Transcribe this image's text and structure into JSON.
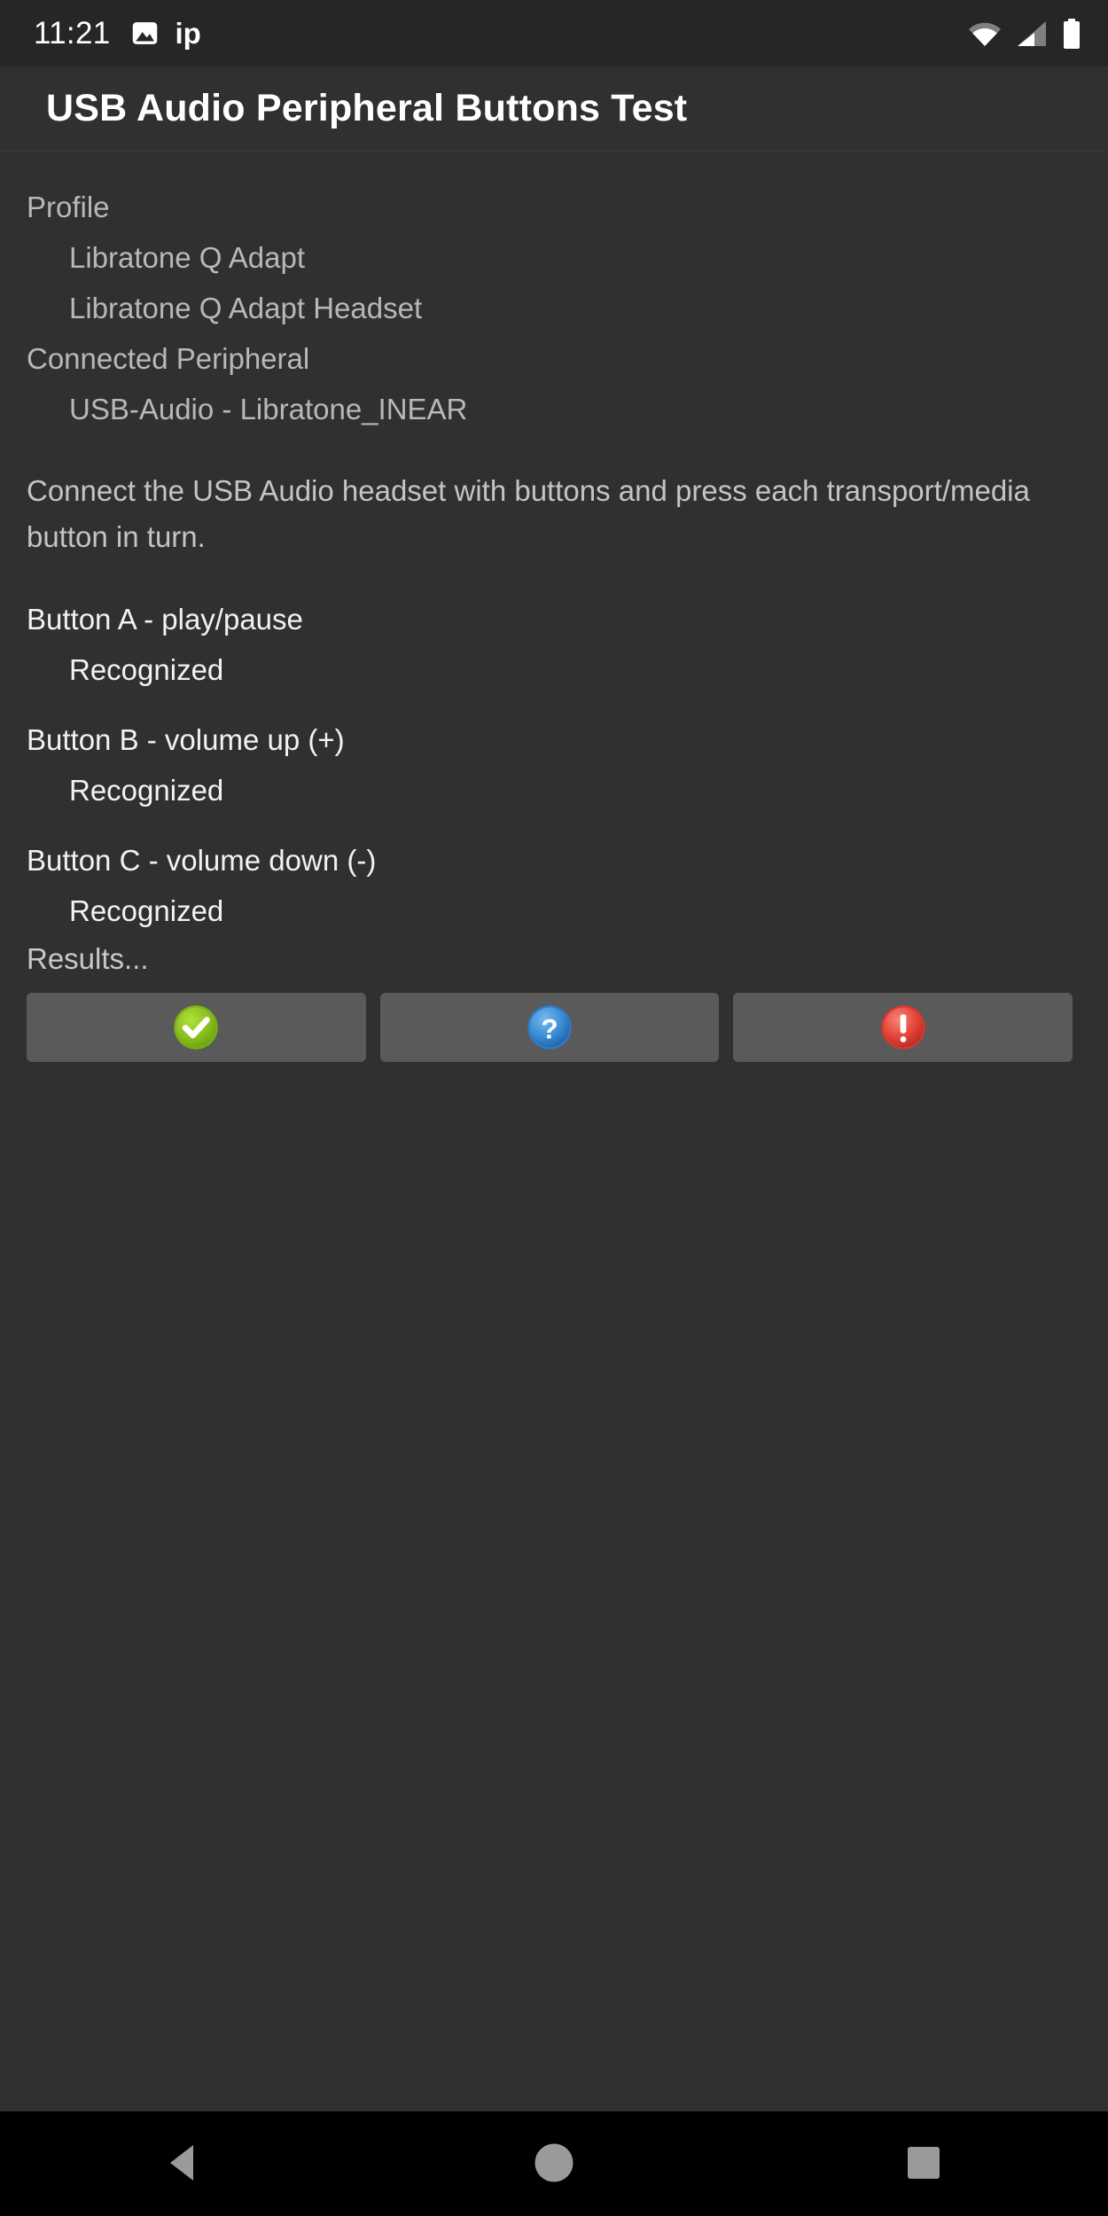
{
  "status_bar": {
    "clock": "11:21",
    "notification_icons": [
      "image-icon"
    ],
    "notification_text": "ip",
    "right_icons": [
      "wifi-icon",
      "cellular-signal-icon",
      "battery-icon"
    ]
  },
  "header": {
    "title": "USB Audio Peripheral Buttons Test"
  },
  "main": {
    "profile_label": "Profile",
    "profile_values": [
      "Libratone Q Adapt",
      "Libratone Q Adapt Headset"
    ],
    "connected_label": "Connected Peripheral",
    "connected_values": [
      "USB-Audio - Libratone_INEAR"
    ],
    "instruction": "Connect the USB Audio headset with buttons and press each transport/media button in turn.",
    "buttons": [
      {
        "label": "Button A - play/pause",
        "status": "Recognized"
      },
      {
        "label": "Button B - volume up (+)",
        "status": "Recognized"
      },
      {
        "label": "Button C - volume down (-)",
        "status": "Recognized"
      }
    ],
    "results_label": "Results..."
  },
  "result_buttons": [
    {
      "name": "pass-button",
      "icon": "check-circle-icon",
      "color": "#8cc11f"
    },
    {
      "name": "info-button",
      "icon": "question-circle-icon",
      "color": "#3e8fd8"
    },
    {
      "name": "fail-button",
      "icon": "exclamation-circle-icon",
      "color": "#e8483c"
    }
  ],
  "nav_bar": {
    "back": "back-triangle-icon",
    "home": "home-circle-icon",
    "recents": "recents-square-icon"
  },
  "colors": {
    "window_background": "#303030",
    "status_bar_background": "#262626",
    "nav_bar_background": "#000000",
    "button_background": "#5a5a5a",
    "text_primary": "#f2f2f2",
    "text_secondary": "#b8b8b8"
  }
}
